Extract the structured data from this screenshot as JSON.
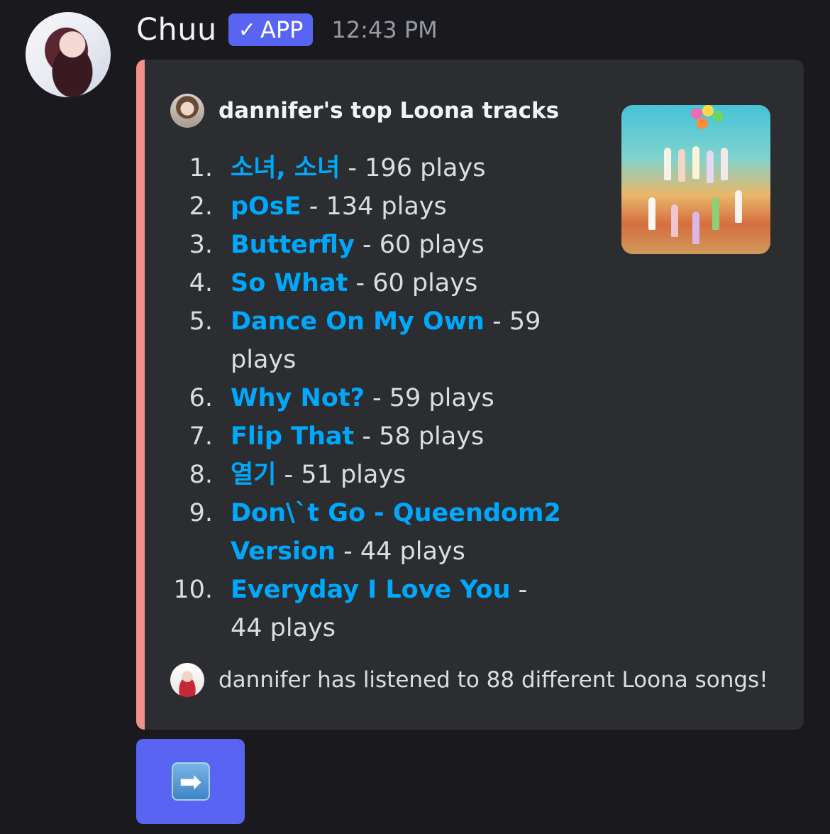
{
  "message": {
    "author": "Chuu",
    "badge": "APP",
    "badge_icon": "check-icon",
    "timestamp": "12:43 PM",
    "avatar_icon": "user-avatar"
  },
  "embed": {
    "accent_color": "#f2908b",
    "author_text": "dannifer's top Loona tracks",
    "tracks": [
      {
        "num": "1.",
        "title": "소녀, 소녀",
        "plays": " - 196 plays"
      },
      {
        "num": "2.",
        "title": "pOsE",
        "plays": " - 134 plays"
      },
      {
        "num": "3.",
        "title": "Butterfly",
        "plays": " - 60 plays"
      },
      {
        "num": "4.",
        "title": "So What",
        "plays": " - 60 plays"
      },
      {
        "num": "5.",
        "title": "Dance On My Own",
        "plays": " - 59 plays"
      },
      {
        "num": "6.",
        "title": "Why Not?",
        "plays": " - 59 plays"
      },
      {
        "num": "7.",
        "title": "Flip That",
        "plays": " - 58 plays"
      },
      {
        "num": "8.",
        "title": "열기",
        "plays": " - 51 plays"
      },
      {
        "num": "9.",
        "title": "Don\\`t Go - Queendom2 Version",
        "plays": " - 44 plays"
      },
      {
        "num": "10.",
        "title": "Everyday I Love You",
        "plays": " - 44 plays"
      }
    ],
    "footer_text": "dannifer has listened to 88 different Loona songs!"
  },
  "button": {
    "icon": "right-arrow-icon",
    "label": "➡"
  },
  "colors": {
    "background": "#1a1a1e",
    "embed_bg": "#2b2d31",
    "link": "#00a8fc",
    "button": "#5865f2"
  }
}
